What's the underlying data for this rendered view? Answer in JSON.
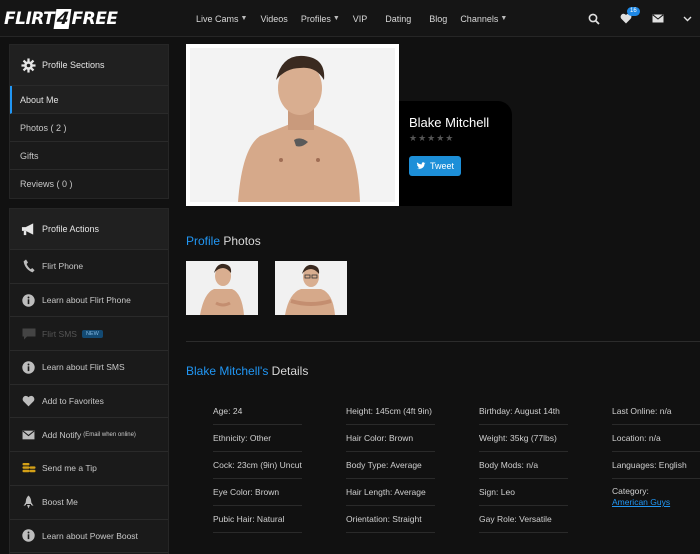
{
  "nav": {
    "logo_left": "FLIRT",
    "logo_mid": "4",
    "logo_right": "FREE",
    "items": [
      "Live Cams",
      "Videos",
      "Profiles",
      "VIP",
      "Dating",
      "Blog",
      "Channels"
    ],
    "notification_count": "16"
  },
  "sidebar": {
    "sections_title": "Profile Sections",
    "sections": [
      "About Me",
      "Photos ( 2 )",
      "Gifts",
      "Reviews ( 0 )"
    ],
    "actions_title": "Profile Actions",
    "actions": [
      {
        "label": "Flirt Phone",
        "icon": "phone-icon"
      },
      {
        "label": "Learn about Flirt Phone",
        "icon": "info-icon"
      },
      {
        "label": "Flirt SMS",
        "icon": "sms-icon",
        "tag": "NEW"
      },
      {
        "label": "Learn about Flirt SMS",
        "icon": "info-icon"
      },
      {
        "label": "Add to Favorites",
        "icon": "heart-icon"
      },
      {
        "label": "Add Notify",
        "icon": "mail-icon",
        "small": "(Email when online)"
      },
      {
        "label": "Send me a Tip",
        "icon": "coins-icon"
      },
      {
        "label": "Boost Me",
        "icon": "rocket-icon"
      },
      {
        "label": "Learn about Power Boost",
        "icon": "info-icon"
      }
    ]
  },
  "profile": {
    "name": "Blake Mitchell",
    "tweet_label": "Tweet"
  },
  "photos_section": {
    "highlight": "Profile",
    "rest": " Photos"
  },
  "details_section": {
    "highlight": "Blake Mitchell's",
    "rest": " Details"
  },
  "details": {
    "col1": [
      "Age: 24",
      "Ethnicity: Other",
      "Cock: 23cm (9in) Uncut",
      "Eye Color: Brown",
      "Pubic Hair: Natural"
    ],
    "col2": [
      "Height: 145cm (4ft 9in)",
      "Hair Color: Brown",
      "Body Type: Average",
      "Hair Length: Average",
      "Orientation: Straight"
    ],
    "col3": [
      "Birthday: August 14th",
      "Weight: 35kg (77lbs)",
      "Body Mods: n/a",
      "Sign: Leo",
      "Gay Role: Versatile"
    ],
    "col4": [
      "Last Online: n/a",
      "Location: n/a",
      "Languages: English"
    ],
    "category_label": "Category:",
    "category_value": "American Guys"
  },
  "colors": {
    "accent": "#2196f3",
    "bg": "#111111",
    "panel": "#1a1a1a",
    "tweet": "#1d8fd8"
  }
}
